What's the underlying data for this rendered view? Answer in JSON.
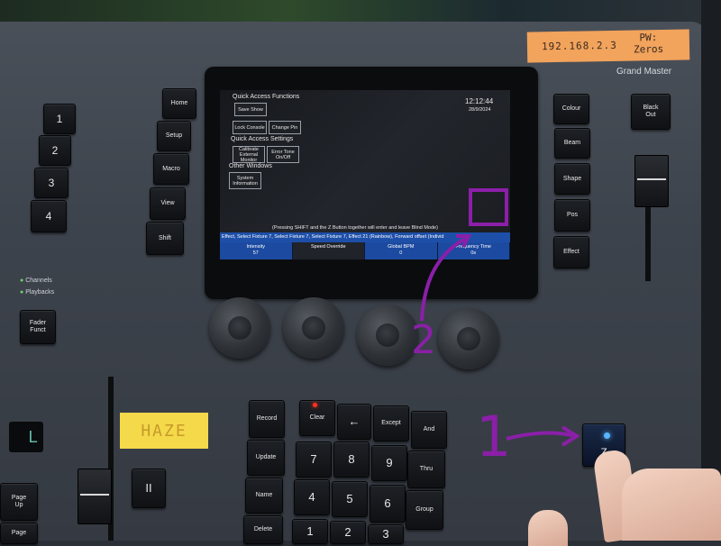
{
  "tape_labels": {
    "ip": "192.168.2.3",
    "pw_line1": "PW:",
    "pw_line2": "Zeros",
    "haze": "HAZE"
  },
  "console_labels": {
    "grand_master": "Grand Master",
    "channels": "Channels",
    "playbacks": "Playbacks"
  },
  "left_keys": {
    "numbers": [
      "1",
      "2",
      "3",
      "4"
    ],
    "fader_funct": "Fader\nFunct",
    "page_up": "Page\nUp",
    "page_down": "Page",
    "pause_icon": "II",
    "display_value": "L"
  },
  "mode_keys": [
    "Home",
    "Setup",
    "Macro",
    "View",
    "Shift"
  ],
  "attribute_keys": [
    "Colour",
    "Beam",
    "Shape",
    "Pos",
    "Effect"
  ],
  "black_out": "Black\nOut",
  "screen": {
    "quick_access_functions": "Quick Access Functions",
    "time": "12:12:44",
    "date": "28/9/2024",
    "save_show": "Save Show",
    "lock_console": "Lock Console",
    "change_pin": "Change Pin",
    "quick_access_settings": "Quick Access Settings",
    "calibrate_external_monitor": "Calibrate External Monitor",
    "error_tone": "Error Tone On/Off",
    "other_windows": "Other Windows",
    "system_information": "System Information",
    "shift_hint": "(Pressing SHIFT and the Z Button together will enter and leave Blind Mode)",
    "command_line": "Effect, Select Fixture 7, Select Fixture 7, Select Fixture 7, Effect 21 (Rainbow), Forward offset (Individ",
    "params": [
      {
        "label": "Intensity",
        "value": "57"
      },
      {
        "label": "Speed Override",
        "value": ""
      },
      {
        "label": "Global BPM",
        "value": "0"
      },
      {
        "label": "Frequency Time",
        "value": "0s"
      }
    ]
  },
  "keypad": {
    "row_labels": [
      "Record",
      "Clear",
      "←",
      "Except",
      "And"
    ],
    "left_column": [
      "Update",
      "Name",
      "Delete"
    ],
    "right_column": [
      "Thru",
      "Group"
    ],
    "digits": [
      "7",
      "8",
      "9",
      "4",
      "5",
      "6",
      "1",
      "2",
      "3"
    ]
  },
  "z_button": "Z",
  "annotations": {
    "step1": "1",
    "step2": "2"
  },
  "colors": {
    "annotation": "#8b1fa8",
    "screen_bar": "#1e4fa8",
    "led_blue": "#59b5ff",
    "led_red": "#ff3020"
  }
}
